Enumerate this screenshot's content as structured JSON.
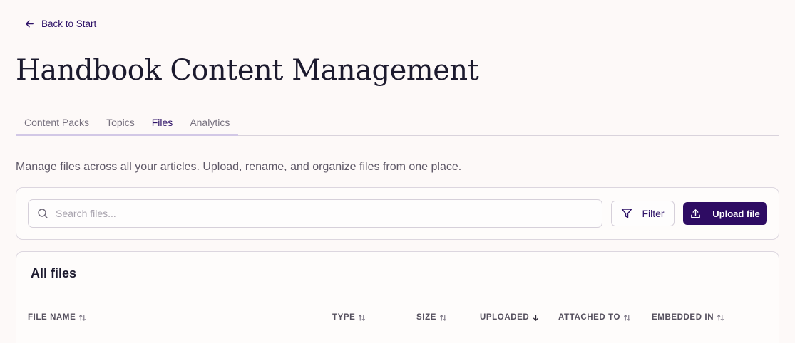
{
  "nav": {
    "back_label": "Back to Start"
  },
  "page": {
    "title": "Handbook Content Management",
    "description": "Manage files across all your articles. Upload, rename, and organize files from one place."
  },
  "tabs": [
    {
      "label": "Content Packs",
      "active": false
    },
    {
      "label": "Topics",
      "active": false
    },
    {
      "label": "Files",
      "active": true
    },
    {
      "label": "Analytics",
      "active": false
    }
  ],
  "toolbar": {
    "search_placeholder": "Search files...",
    "filter_label": "Filter",
    "upload_label": "Upload file"
  },
  "files": {
    "title": "All files",
    "columns": [
      {
        "label": "FILE NAME",
        "sort": "sortable"
      },
      {
        "label": "TYPE",
        "sort": "sortable"
      },
      {
        "label": "SIZE",
        "sort": "sortable"
      },
      {
        "label": "UPLOADED",
        "sort": "descending"
      },
      {
        "label": "ATTACHED TO",
        "sort": "sortable"
      },
      {
        "label": "EMBEDDED IN",
        "sort": "sortable"
      }
    ]
  },
  "colors": {
    "accent": "#2e0c63",
    "background": "#fdf9f8",
    "border": "#dcd6df"
  }
}
